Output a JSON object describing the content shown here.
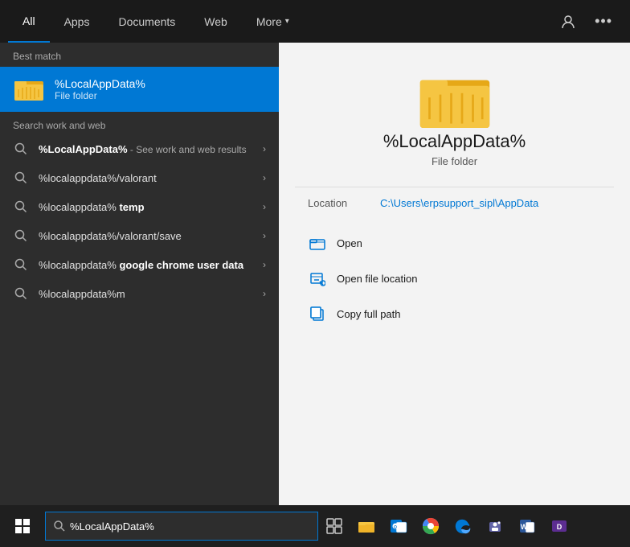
{
  "nav": {
    "tabs": [
      {
        "label": "All",
        "active": true
      },
      {
        "label": "Apps",
        "active": false
      },
      {
        "label": "Documents",
        "active": false
      },
      {
        "label": "Web",
        "active": false
      },
      {
        "label": "More",
        "active": false,
        "has_chevron": true
      }
    ],
    "icons": {
      "user": "👤",
      "ellipsis": "···"
    }
  },
  "left": {
    "best_match_label": "Best match",
    "best_match": {
      "title": "%LocalAppData%",
      "subtitle": "File folder"
    },
    "search_section_label": "Search work and web",
    "results": [
      {
        "text_main": "%LocalAppData%",
        "text_extra": " - See work and web results",
        "has_chevron": true
      },
      {
        "text_main": "%localappdata%/valorant",
        "has_chevron": true
      },
      {
        "text_main": "%localappdata% temp",
        "has_chevron": true
      },
      {
        "text_main": "%localappdata%/valorant/save",
        "has_chevron": true
      },
      {
        "text_main": "%localappdata% google chrome user data",
        "has_chevron": true
      },
      {
        "text_main": "%localappdata%m",
        "has_chevron": true
      }
    ]
  },
  "right": {
    "title": "%LocalAppData%",
    "subtitle": "File folder",
    "location_label": "Location",
    "location_path": "C:\\Users\\erpsupport_sipl\\AppData",
    "actions": [
      {
        "label": "Open",
        "icon": "folder-open"
      },
      {
        "label": "Open file location",
        "icon": "file-location"
      },
      {
        "label": "Copy full path",
        "icon": "copy"
      }
    ]
  },
  "taskbar": {
    "search_value": "%LocalAppData%",
    "search_placeholder": "%LocalAppData%"
  }
}
